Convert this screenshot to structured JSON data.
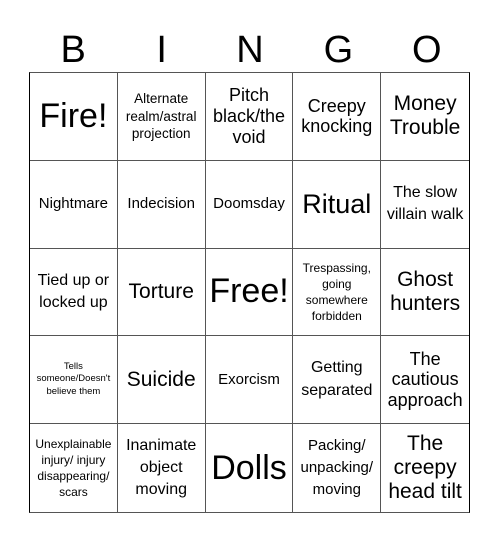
{
  "header": {
    "letters": [
      "B",
      "I",
      "N",
      "G",
      "O"
    ]
  },
  "cells": [
    {
      "text": "Fire!",
      "size": "s-xl"
    },
    {
      "text": "Alternate realm/astral projection",
      "size": "s-sm"
    },
    {
      "text": "Pitch black/the void",
      "size": "s-m"
    },
    {
      "text": "Creepy knocking",
      "size": "s-m"
    },
    {
      "text": "Money Trouble",
      "size": "s-ml"
    },
    {
      "text": "Nightmare",
      "size": "s-s"
    },
    {
      "text": "Indecision",
      "size": "s-s"
    },
    {
      "text": "Doomsday",
      "size": "s-s"
    },
    {
      "text": "Ritual",
      "size": "s-l"
    },
    {
      "text": "The slow villain walk",
      "size": "s-ms"
    },
    {
      "text": "Tied up or locked up",
      "size": "s-ms"
    },
    {
      "text": "Torture",
      "size": "s-ml"
    },
    {
      "text": "Free!",
      "size": "s-xl"
    },
    {
      "text": "Trespassing, going somewhere forbidden",
      "size": "s-xs"
    },
    {
      "text": "Ghost hunters",
      "size": "s-ml"
    },
    {
      "text": "Tells someone/Doesn't believe them",
      "size": "s-xxs"
    },
    {
      "text": "Suicide",
      "size": "s-ml"
    },
    {
      "text": "Exorcism",
      "size": "s-s"
    },
    {
      "text": "Getting separated",
      "size": "s-ms"
    },
    {
      "text": "The cautious approach",
      "size": "s-m"
    },
    {
      "text": "Unexplainable injury/ injury disappearing/ scars",
      "size": "s-xs"
    },
    {
      "text": "Inanimate object moving",
      "size": "s-ms"
    },
    {
      "text": "Dolls",
      "size": "s-xl"
    },
    {
      "text": "Packing/ unpacking/ moving",
      "size": "s-s"
    },
    {
      "text": "The creepy head tilt",
      "size": "s-ml"
    }
  ]
}
